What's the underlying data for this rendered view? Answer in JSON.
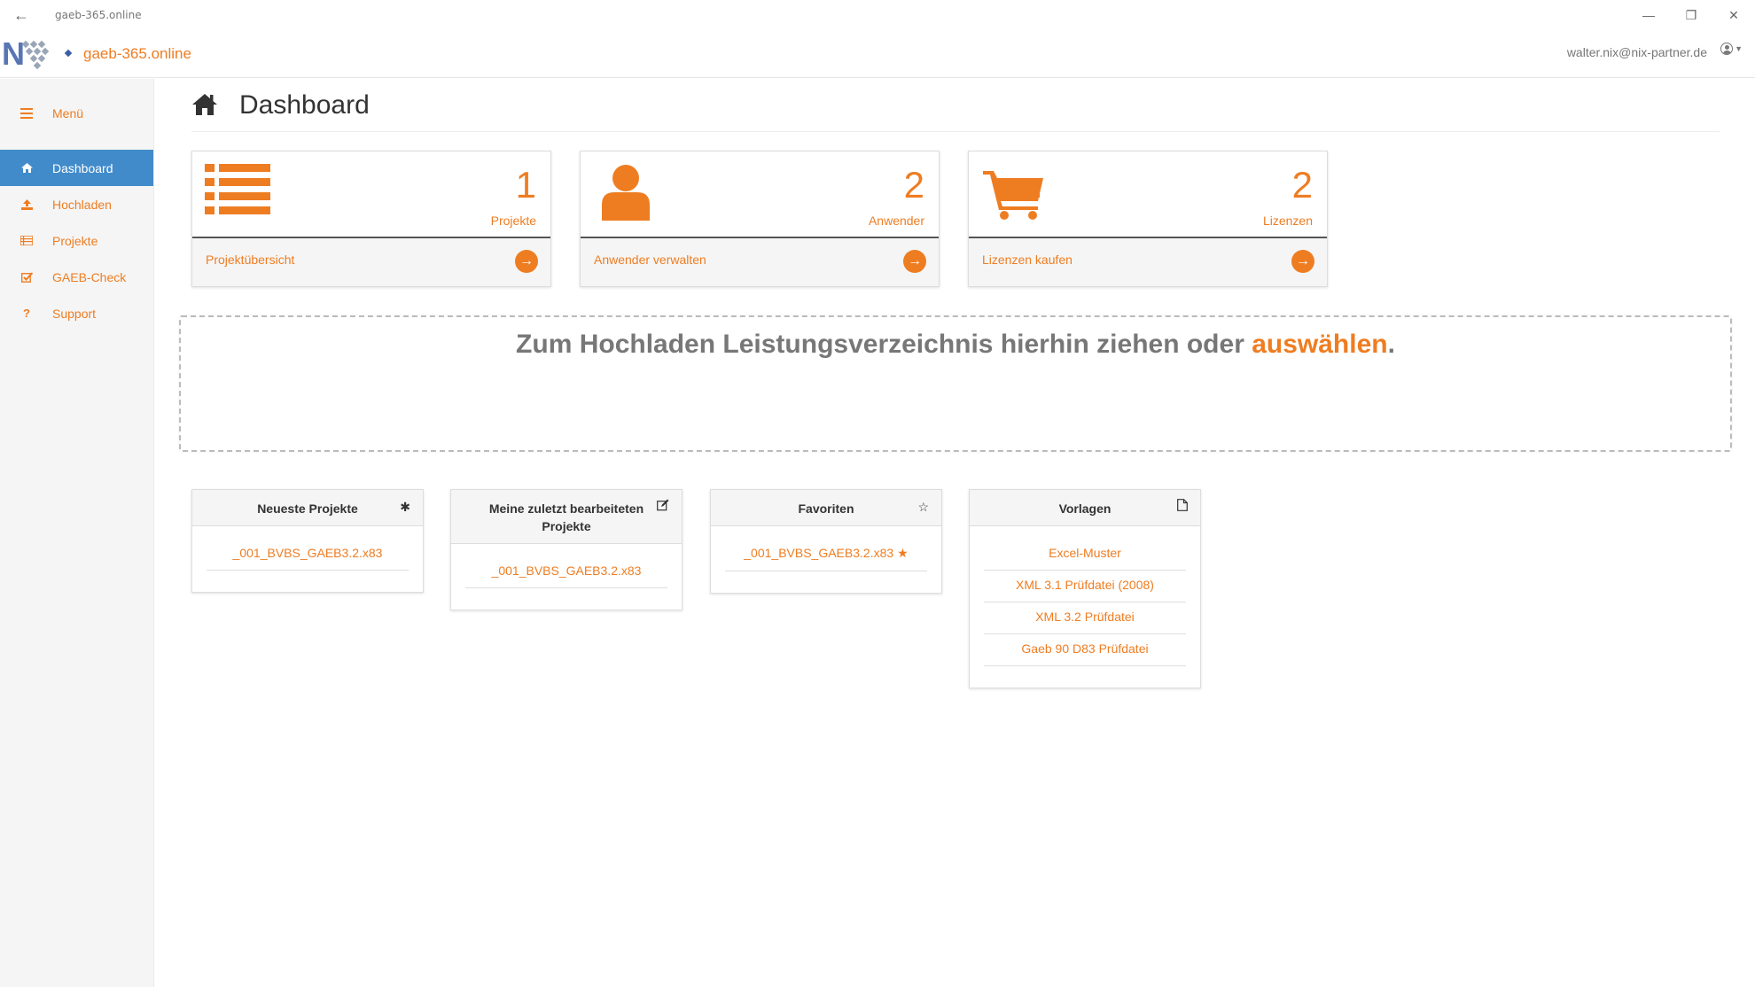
{
  "window": {
    "title": "gaeb-365.online"
  },
  "header": {
    "brand": "gaeb-365.online",
    "user_email": "walter.nix@nix-partner.de"
  },
  "sidebar": {
    "menu_label": "Menü",
    "items": [
      {
        "label": "Dashboard",
        "icon": "home-icon"
      },
      {
        "label": "Hochladen",
        "icon": "upload-icon"
      },
      {
        "label": "Projekte",
        "icon": "list-icon"
      },
      {
        "label": "GAEB-Check",
        "icon": "check-square-icon"
      },
      {
        "label": "Support",
        "icon": "question-icon"
      }
    ]
  },
  "page": {
    "title": "Dashboard"
  },
  "stats": [
    {
      "count": "1",
      "label": "Projekte",
      "link": "Projektübersicht",
      "icon": "list-icon"
    },
    {
      "count": "2",
      "label": "Anwender",
      "link": "Anwender verwalten",
      "icon": "user-icon"
    },
    {
      "count": "2",
      "label": "Lizenzen",
      "link": "Lizenzen kaufen",
      "icon": "cart-icon"
    }
  ],
  "dropzone": {
    "text": "Zum Hochladen Leistungsverzeichnis hierhin ziehen oder ",
    "link": "auswählen",
    "suffix": "."
  },
  "panels": {
    "newest": {
      "title": "Neueste Projekte",
      "items": [
        "_001_BVBS_GAEB3.2.x83"
      ]
    },
    "recent": {
      "title": "Meine zuletzt bearbeiteten Projekte",
      "items": [
        "_001_BVBS_GAEB3.2.x83"
      ]
    },
    "favorites": {
      "title": "Favoriten",
      "items": [
        "_001_BVBS_GAEB3.2.x83"
      ]
    },
    "templates": {
      "title": "Vorlagen",
      "items": [
        "Excel-Muster",
        "XML 3.1 Prüfdatei (2008)",
        "XML 3.2 Prüfdatei",
        "Gaeb 90 D83 Prüfdatei"
      ]
    }
  },
  "colors": {
    "accent": "#ee7d22",
    "active": "#428bca"
  }
}
